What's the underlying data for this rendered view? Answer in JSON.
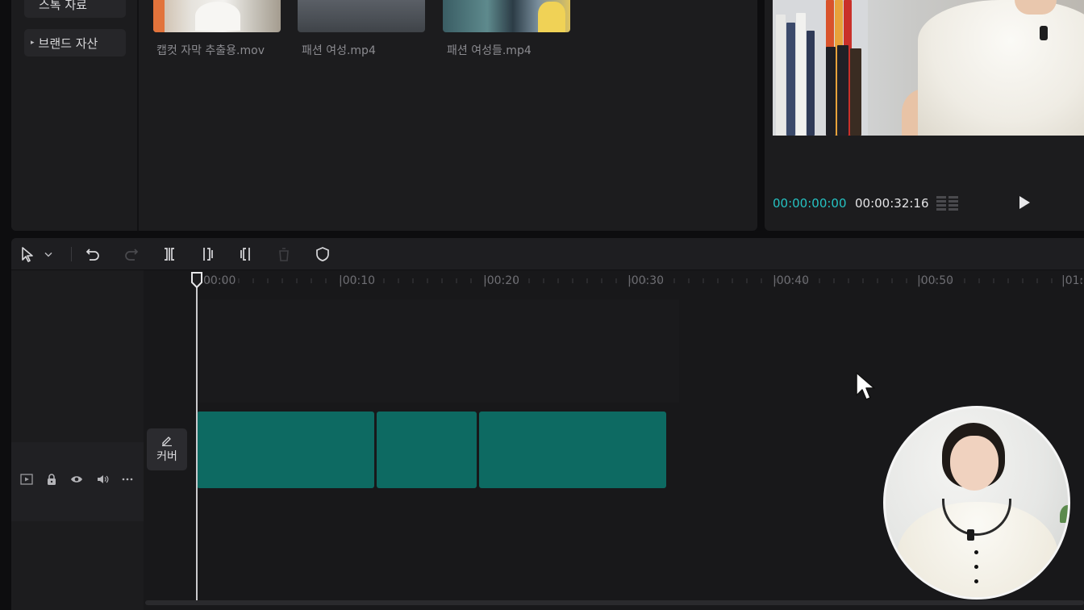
{
  "library": {
    "nav": [
      {
        "label": "스톡 자료",
        "caret": ""
      },
      {
        "label": "브랜드 자산",
        "caret": "▸"
      }
    ],
    "media": [
      {
        "name": "캡컷 자막 추출용.mov"
      },
      {
        "name": "패션 여성.mp4"
      },
      {
        "name": "패션 여성들.mp4"
      }
    ]
  },
  "player": {
    "current_time": "00:00:00:00",
    "total_time": "00:00:32:16",
    "accent_color": "#25c2c2"
  },
  "toolbar": {
    "tools": [
      "select-pointer-icon",
      "chevron-down-icon",
      "undo-icon",
      "redo-icon",
      "split-icon",
      "trim-left-icon",
      "trim-right-icon",
      "delete-icon",
      "shield-icon"
    ]
  },
  "timeline": {
    "ruler_labels": [
      "00:00",
      "|00:10",
      "|00:20",
      "|00:30",
      "|00:40",
      "|00:50",
      "|01:"
    ],
    "cover_label": "커버",
    "track_icons": [
      "video-track-icon",
      "lock-icon",
      "eye-icon",
      "speaker-icon",
      "more-icon"
    ],
    "clip_color": "#0d6a62",
    "clips": [
      {
        "id": "clip-1"
      },
      {
        "id": "clip-2"
      },
      {
        "id": "clip-3"
      }
    ]
  }
}
